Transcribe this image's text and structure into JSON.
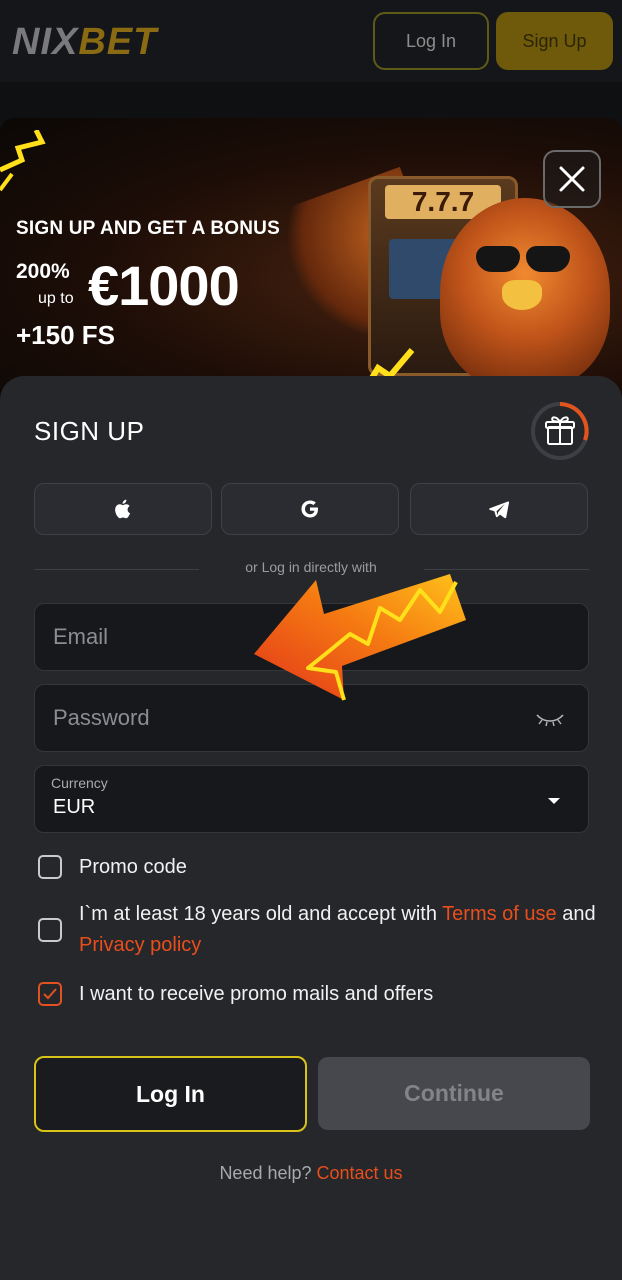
{
  "header": {
    "logo_nix": "NIX",
    "logo_bet": "BET",
    "login_label": "Log In",
    "signup_label": "Sign Up"
  },
  "banner": {
    "headline": "SIGN UP AND GET A BONUS",
    "percent": "200%",
    "up_to": "up to",
    "amount": "€1000",
    "free_spins": "+150 FS",
    "slot_reels": "7.7.7"
  },
  "form": {
    "title": "SIGN UP",
    "social": [
      "apple-icon",
      "google-icon",
      "telegram-icon"
    ],
    "divider_text": "or Log in directly with",
    "email_placeholder": "Email",
    "password_placeholder": "Password",
    "currency_label": "Currency",
    "currency_value": "EUR",
    "promo_label": "Promo code",
    "promo_checked": false,
    "age_text_pre": "I`m at least 18 years old and accept with ",
    "age_link_terms": "Terms of use",
    "age_text_and": " and ",
    "age_link_privacy": "Privacy policy",
    "age_checked": false,
    "mails_label": "I want to receive promo mails and offers",
    "mails_checked": true,
    "login_button": "Log In",
    "continue_button": "Continue",
    "help_text": "Need help? ",
    "help_link": "Contact us"
  },
  "colors": {
    "accent_orange": "#e94e1b",
    "accent_yellow": "#d9c21a",
    "panel_bg": "#25272b",
    "input_bg": "#17181b"
  }
}
